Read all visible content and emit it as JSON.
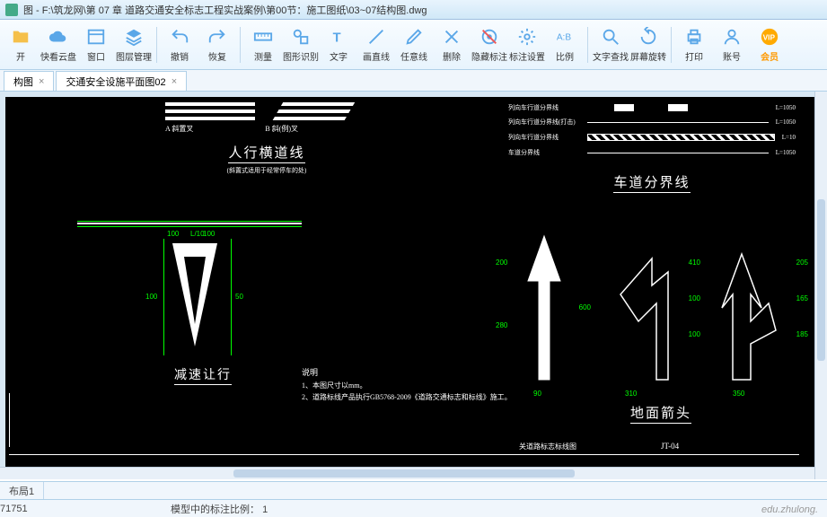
{
  "title": "图 - F:\\筑龙网\\第 07 章 道路交通安全标志工程实战案例\\第00节：施工图纸\\03~07结构图.dwg",
  "toolbar": [
    {
      "label": "开",
      "icon": "folder",
      "color": "#f5c04a"
    },
    {
      "label": "快看云盘",
      "icon": "cloud",
      "color": "#5aa7e8"
    },
    {
      "label": "窗口",
      "icon": "window",
      "color": "#5aa7e8"
    },
    {
      "label": "图层管理",
      "icon": "layers",
      "color": "#5aa7e8"
    },
    {
      "sep": true
    },
    {
      "label": "撤销",
      "icon": "undo",
      "color": "#5aa7e8"
    },
    {
      "label": "恢复",
      "icon": "redo",
      "color": "#5aa7e8"
    },
    {
      "sep": true
    },
    {
      "label": "测量",
      "icon": "ruler",
      "color": "#5aa7e8"
    },
    {
      "label": "图形识别",
      "icon": "shapes",
      "color": "#5aa7e8"
    },
    {
      "label": "文字",
      "icon": "text",
      "color": "#5aa7e8"
    },
    {
      "label": "画直线",
      "icon": "line",
      "color": "#5aa7e8"
    },
    {
      "label": "任意线",
      "icon": "pencil",
      "color": "#5aa7e8"
    },
    {
      "label": "删除",
      "icon": "erase",
      "color": "#5aa7e8"
    },
    {
      "label": "隐藏标注",
      "icon": "hide",
      "color": "#5aa7e8"
    },
    {
      "label": "标注设置",
      "icon": "gear",
      "color": "#5aa7e8"
    },
    {
      "label": "比例",
      "icon": "ratio",
      "color": "#5aa7e8"
    },
    {
      "sep": true
    },
    {
      "label": "文字查找",
      "icon": "search",
      "color": "#5aa7e8"
    },
    {
      "label": "屏幕旋转",
      "icon": "rotate",
      "color": "#5aa7e8"
    },
    {
      "sep": true
    },
    {
      "label": "打印",
      "icon": "print",
      "color": "#5aa7e8"
    },
    {
      "label": "账号",
      "icon": "user",
      "color": "#5aa7e8"
    },
    {
      "label": "会员",
      "icon": "vip",
      "color": "#ffaa00",
      "vip": true
    }
  ],
  "tabs": [
    {
      "label": "构图",
      "active": false
    },
    {
      "label": "交通安全设施平面图02",
      "active": true
    }
  ],
  "drawing": {
    "section1_label_a": "A 斜置叉",
    "section1_label_b": "B 斜(例)叉",
    "section1_title": "人行横道线",
    "section1_note": "(斜置式适用于经常停车的处)",
    "section2_title": "车道分界线",
    "section2_row1": "列向车行道分界线",
    "section2_row2": "列向车行道分界线(打击)",
    "section2_row3": "列向车行道分界线",
    "section2_row4": "车道分界线",
    "section2_v1": "L=1050",
    "section2_v2": "L=1050",
    "section2_v3": "L=10",
    "section2_v4": "L=1050",
    "section3_title": "减速让行",
    "section3_dim1": "L/10",
    "section4_title": "地面箭头",
    "notes_title": "说明",
    "notes_1": "1、本图尺寸以mm。",
    "notes_2": "2、道路标线产品执行GB5768-2009《道路交通标志和标线》施工。",
    "footer_label": "关道路标志标线图",
    "footer_code": "JT-04",
    "dims": {
      "d200": "200",
      "d280": "280",
      "d310": "310",
      "d100": "100",
      "d50": "50",
      "d90": "90",
      "d410": "410",
      "d350": "350",
      "d205": "205",
      "d165": "165",
      "d185": "185",
      "d600": "600"
    }
  },
  "status": {
    "layout": "布局1",
    "coord": "71751",
    "scale_label": "模型中的标注比例：",
    "scale_value": "1"
  },
  "watermark": "edu.zhulong."
}
